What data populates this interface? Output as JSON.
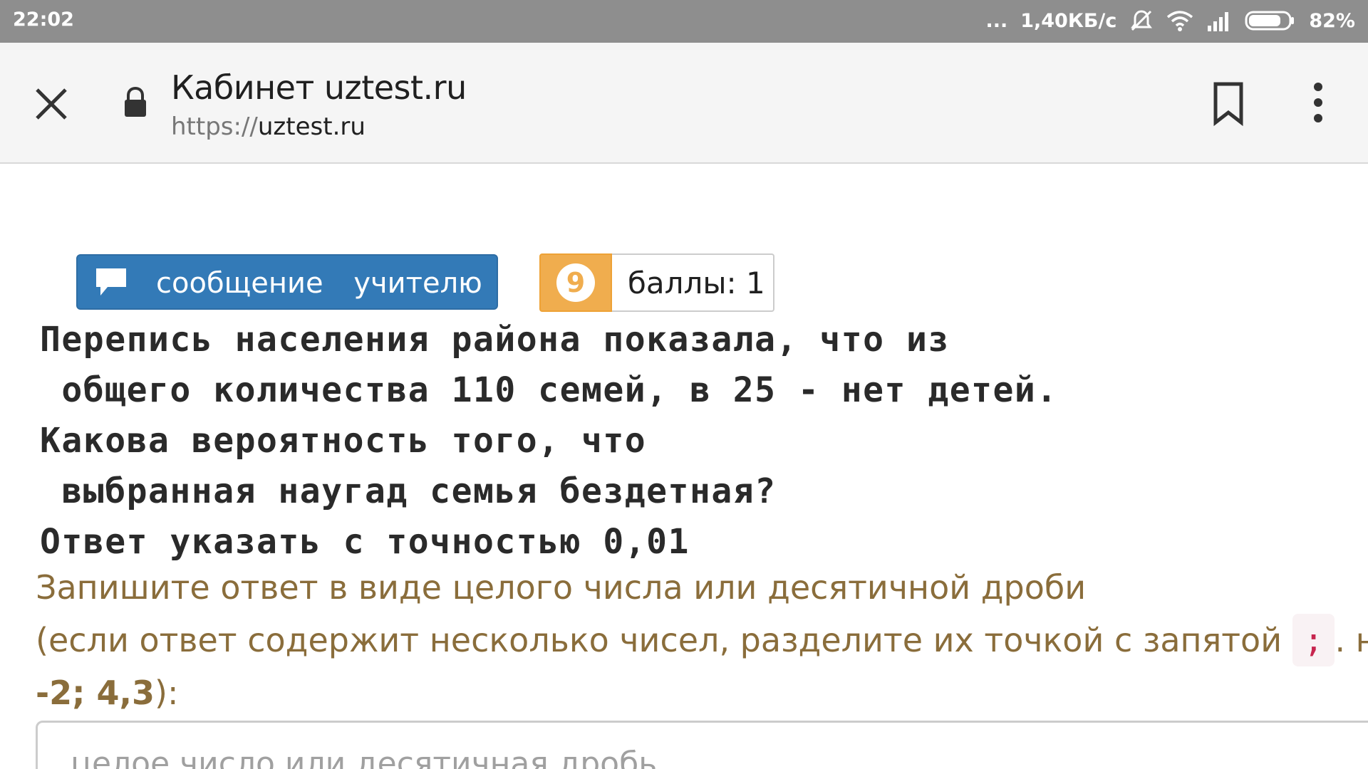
{
  "status_bar": {
    "time": "22:02",
    "dots": "...",
    "network_speed": "1,40КБ/с",
    "battery_percent": "82%",
    "battery_level": 0.82,
    "icons": [
      "mute-icon",
      "wifi-icon",
      "signal-icon",
      "battery-icon"
    ]
  },
  "browser": {
    "title": "Кабинет uztest.ru",
    "url_scheme": "https://",
    "url_host": "uztest.ru",
    "icons": [
      "close-icon",
      "lock-icon",
      "bookmark-icon",
      "more-vert-icon"
    ]
  },
  "task": {
    "message_button_label": "сообщение учителю",
    "task_number": "9",
    "points_label": "баллы: 1",
    "question_lines": [
      "Перепись населения района показала, что из",
      " общего количества 110 семей, в 25 - нет детей.",
      "Какова вероятность того, что",
      " выбранная наугад семья бездетная?",
      "Ответ указать с точностью 0,01"
    ],
    "instruction_line1": "Запишите ответ в виде целого числа или десятичной дроби",
    "instruction_line2_before": "(если ответ содержит несколько чисел, разделите их точкой с запятой",
    "separator_chip": ";",
    "instruction_line2_after": ". н",
    "example_value": "-2; 4,3",
    "example_suffix": "):",
    "answer_placeholder": "целое число или десятичная дробь",
    "answer_value": ""
  },
  "colors": {
    "status_bar_bg": "#8e8e8e",
    "primary_button": "#337ab7",
    "warning_badge": "#f0ad4e",
    "instruction_text": "#8a6d3b",
    "code_text": "#c7254e"
  }
}
